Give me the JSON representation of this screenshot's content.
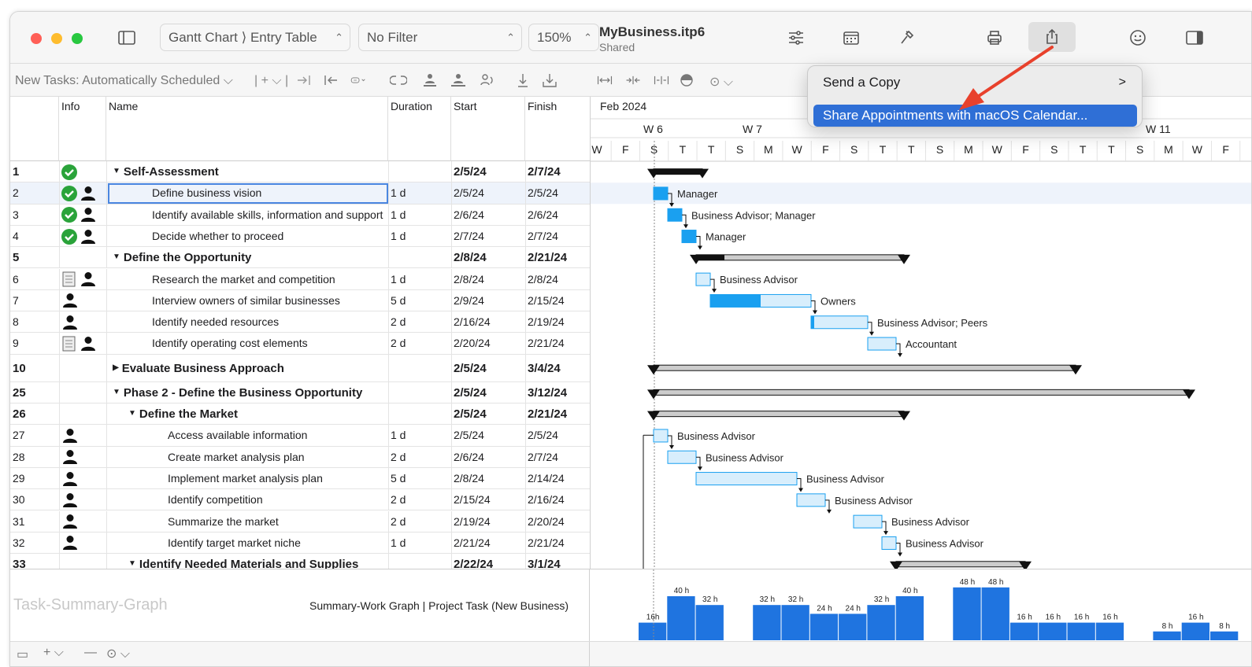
{
  "window": {
    "title": "MyBusiness.itp6",
    "subtitle": "Shared",
    "view_popup": "Gantt Chart ⟩ Entry Table",
    "filter_popup": "No Filter",
    "zoom_popup": "150%"
  },
  "toolbar2": {
    "new_tasks": "New Tasks: Automatically Scheduled"
  },
  "columns": {
    "num": "",
    "info": "Info",
    "name": "Name",
    "duration": "Duration",
    "start": "Start",
    "finish": "Finish"
  },
  "rows": [
    {
      "num": "1",
      "info": "check",
      "name": "Self-Assessment",
      "duration": "",
      "start": "2/5/24",
      "finish": "2/7/24",
      "bold": true,
      "level": 0,
      "tri": "down"
    },
    {
      "num": "2",
      "info": "check-person",
      "name": "Define business vision",
      "duration": "1 d",
      "start": "2/5/24",
      "finish": "2/5/24",
      "bold": false,
      "level": 1,
      "tri": "",
      "sel": true
    },
    {
      "num": "3",
      "info": "check-person",
      "name": "Identify available skills, information and support",
      "duration": "1 d",
      "start": "2/6/24",
      "finish": "2/6/24",
      "bold": false,
      "level": 1,
      "tri": ""
    },
    {
      "num": "4",
      "info": "check-person",
      "name": "Decide whether to proceed",
      "duration": "1 d",
      "start": "2/7/24",
      "finish": "2/7/24",
      "bold": false,
      "level": 1,
      "tri": ""
    },
    {
      "num": "5",
      "info": "",
      "name": "Define the Opportunity",
      "duration": "",
      "start": "2/8/24",
      "finish": "2/21/24",
      "bold": true,
      "level": 0,
      "tri": "down"
    },
    {
      "num": "6",
      "info": "note-person",
      "name": "Research the market and competition",
      "duration": "1 d",
      "start": "2/8/24",
      "finish": "2/8/24",
      "bold": false,
      "level": 1,
      "tri": ""
    },
    {
      "num": "7",
      "info": "person",
      "name": "Interview owners of similar businesses",
      "duration": "5 d",
      "start": "2/9/24",
      "finish": "2/15/24",
      "bold": false,
      "level": 1,
      "tri": ""
    },
    {
      "num": "8",
      "info": "person",
      "name": "Identify needed resources",
      "duration": "2 d",
      "start": "2/16/24",
      "finish": "2/19/24",
      "bold": false,
      "level": 1,
      "tri": ""
    },
    {
      "num": "9",
      "info": "note-person",
      "name": "Identify operating cost elements",
      "duration": "2 d",
      "start": "2/20/24",
      "finish": "2/21/24",
      "bold": false,
      "level": 1,
      "tri": ""
    },
    {
      "num": "10",
      "info": "",
      "name": "Evaluate Business Approach",
      "duration": "",
      "start": "2/5/24",
      "finish": "3/4/24",
      "bold": true,
      "level": 0,
      "tri": "right",
      "tall": true
    },
    {
      "num": "25",
      "info": "",
      "name": "Phase 2 - Define the Business Opportunity",
      "duration": "",
      "start": "2/5/24",
      "finish": "3/12/24",
      "bold": true,
      "level": 0,
      "tri": "down"
    },
    {
      "num": "26",
      "info": "",
      "name": "Define the Market",
      "duration": "",
      "start": "2/5/24",
      "finish": "2/21/24",
      "bold": true,
      "level": 1,
      "tri": "down"
    },
    {
      "num": "27",
      "info": "person",
      "name": "Access available information",
      "duration": "1 d",
      "start": "2/5/24",
      "finish": "2/5/24",
      "bold": false,
      "level": 2,
      "tri": ""
    },
    {
      "num": "28",
      "info": "person",
      "name": "Create market analysis plan",
      "duration": "2 d",
      "start": "2/6/24",
      "finish": "2/7/24",
      "bold": false,
      "level": 2,
      "tri": ""
    },
    {
      "num": "29",
      "info": "person",
      "name": "Implement market analysis plan",
      "duration": "5 d",
      "start": "2/8/24",
      "finish": "2/14/24",
      "bold": false,
      "level": 2,
      "tri": ""
    },
    {
      "num": "30",
      "info": "person",
      "name": "Identify competition",
      "duration": "2 d",
      "start": "2/15/24",
      "finish": "2/16/24",
      "bold": false,
      "level": 2,
      "tri": ""
    },
    {
      "num": "31",
      "info": "person",
      "name": "Summarize the market",
      "duration": "2 d",
      "start": "2/19/24",
      "finish": "2/20/24",
      "bold": false,
      "level": 2,
      "tri": ""
    },
    {
      "num": "32",
      "info": "person",
      "name": "Identify target market niche",
      "duration": "1 d",
      "start": "2/21/24",
      "finish": "2/21/24",
      "bold": false,
      "level": 2,
      "tri": ""
    },
    {
      "num": "33",
      "info": "",
      "name": "Identify Needed Materials and Supplies",
      "duration": "",
      "start": "2/22/24",
      "finish": "3/1/24",
      "bold": true,
      "level": 1,
      "tri": "down"
    }
  ],
  "gantt": {
    "month": "Feb 2024",
    "weeks": [
      "W 6",
      "W 7",
      "W 11"
    ],
    "days": [
      "W",
      "F",
      "S",
      "T",
      "T",
      "S",
      "M",
      "W",
      "F",
      "S",
      "T",
      "T",
      "S",
      "M",
      "W",
      "F",
      "S",
      "T",
      "T",
      "S",
      "M",
      "W",
      "F"
    ],
    "resource_labels": [
      "Manager",
      "Business Advisor; Manager",
      "Manager",
      "Business Advisor",
      "Owners",
      "Business Advisor; Peers",
      "Accountant",
      "Business Advisor",
      "Business Advisor",
      "Business Advisor",
      "Business Advisor",
      "Business Advisor",
      "Business Advisor"
    ]
  },
  "bottom": {
    "graph_title": "Task-Summary-Graph",
    "graph_caption": "Summary-Work Graph | Project Task (New Business)",
    "bars": [
      {
        "label": "16h",
        "value": 16
      },
      {
        "label": "40 h",
        "value": 40
      },
      {
        "label": "32 h",
        "value": 32
      },
      {
        "label": "",
        "value": 0
      },
      {
        "label": "32 h",
        "value": 32
      },
      {
        "label": "32 h",
        "value": 32
      },
      {
        "label": "24 h",
        "value": 24
      },
      {
        "label": "24 h",
        "value": 24
      },
      {
        "label": "32 h",
        "value": 32
      },
      {
        "label": "40 h",
        "value": 40
      },
      {
        "label": "",
        "value": 0
      },
      {
        "label": "48 h",
        "value": 48
      },
      {
        "label": "48 h",
        "value": 48
      },
      {
        "label": "16 h",
        "value": 16
      },
      {
        "label": "16 h",
        "value": 16
      },
      {
        "label": "16 h",
        "value": 16
      },
      {
        "label": "16 h",
        "value": 16
      },
      {
        "label": "",
        "value": 0
      },
      {
        "label": "8 h",
        "value": 8
      },
      {
        "label": "16 h",
        "value": 16
      },
      {
        "label": "8 h",
        "value": 8
      }
    ]
  },
  "menu": {
    "items": [
      "Send a Copy",
      "Share Appointments with macOS Calendar..."
    ]
  },
  "colors": {
    "accent": "#2f6fd6",
    "task_blue": "#1aa0f0",
    "task_light": "#d8eefc",
    "arrow_red": "#e8412c",
    "check_green": "#2aa33a"
  }
}
